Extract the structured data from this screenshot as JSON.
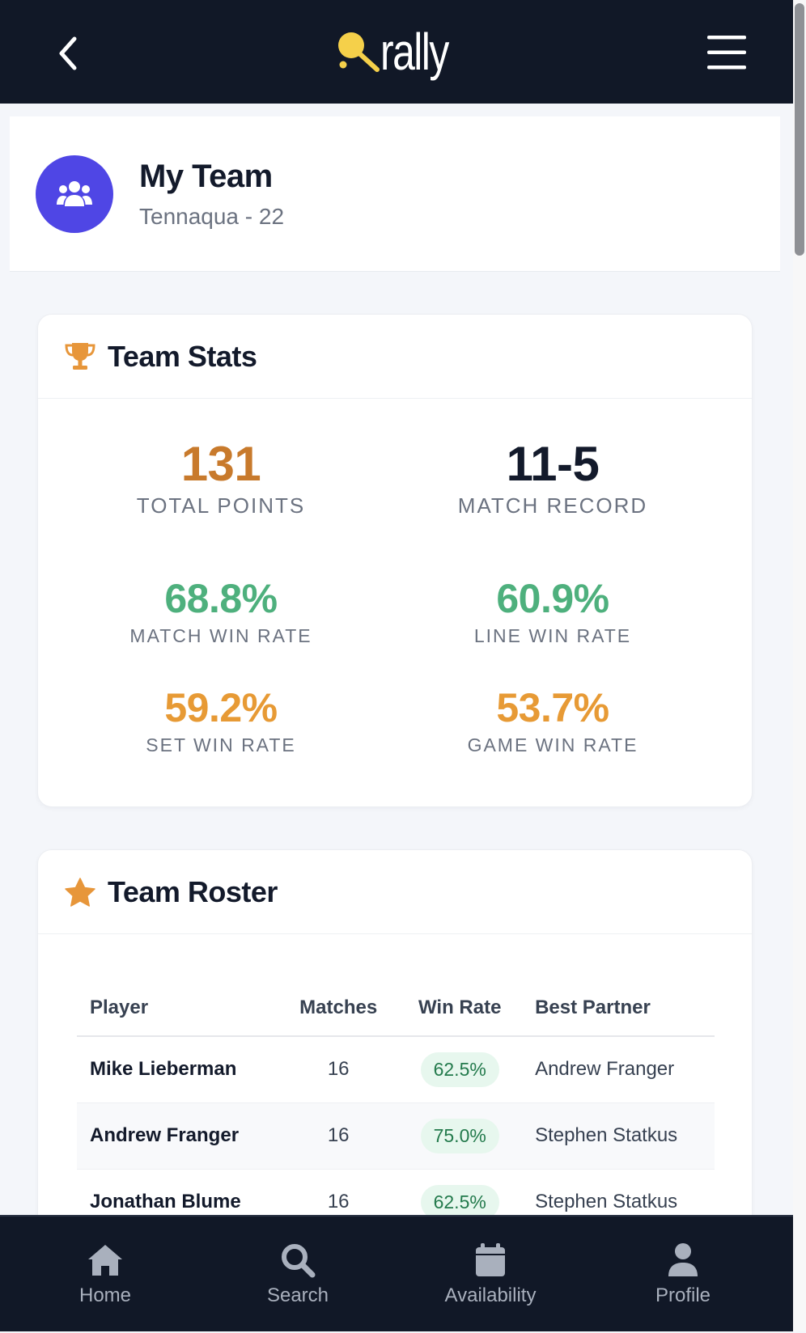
{
  "app": {
    "name": "rally"
  },
  "colors": {
    "nav_bg": "#111827",
    "accent_purple": "#4f46e5",
    "points_orange": "#c87a2c",
    "green": "#4eb07d",
    "amber": "#e79a35",
    "logo_yellow": "#f5d04a"
  },
  "header": {
    "title": "My Team",
    "subtitle": "Tennaqua - 22",
    "avatar_icon": "users-icon"
  },
  "team_stats": {
    "title": "Team Stats",
    "icon": "trophy-icon",
    "items": [
      {
        "value": "131",
        "label": "TOTAL POINTS"
      },
      {
        "value": "11-5",
        "label": "MATCH RECORD"
      },
      {
        "value": "68.8%",
        "label": "MATCH WIN RATE"
      },
      {
        "value": "60.9%",
        "label": "LINE WIN RATE"
      },
      {
        "value": "59.2%",
        "label": "SET WIN RATE"
      },
      {
        "value": "53.7%",
        "label": "GAME WIN RATE"
      }
    ]
  },
  "roster": {
    "title": "Team Roster",
    "icon": "star-icon",
    "columns": [
      "Player",
      "Matches",
      "Win Rate",
      "Best Partner"
    ],
    "rows": [
      {
        "player": "Mike Lieberman",
        "matches": "16",
        "win_rate": "62.5%",
        "best_partner": "Andrew Franger"
      },
      {
        "player": "Andrew Franger",
        "matches": "16",
        "win_rate": "75.0%",
        "best_partner": "Stephen Statkus"
      },
      {
        "player": "Jonathan Blume",
        "matches": "16",
        "win_rate": "62.5%",
        "best_partner": "Stephen Statkus"
      }
    ]
  },
  "bottom_nav": [
    {
      "label": "Home",
      "icon": "home-icon"
    },
    {
      "label": "Search",
      "icon": "search-icon"
    },
    {
      "label": "Availability",
      "icon": "calendar-icon"
    },
    {
      "label": "Profile",
      "icon": "user-icon"
    }
  ]
}
